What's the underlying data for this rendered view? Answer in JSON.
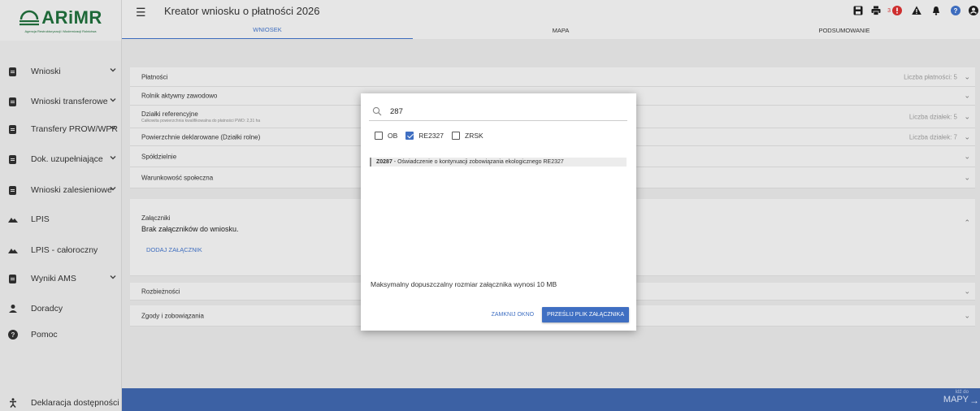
{
  "logo": {
    "name": "ARiMR",
    "subtitle": "Agencja Restrukturyzacji i Modernizacji Rolnictwa"
  },
  "header": {
    "title": "Kreator wniosku o płatności 2026",
    "tabs": [
      {
        "label": "WNIOSEK"
      },
      {
        "label": "MAPA"
      },
      {
        "label": "PODSUMOWANIE"
      }
    ],
    "notification_count": "3"
  },
  "sidebar": {
    "items": [
      {
        "label": "Wnioski"
      },
      {
        "label": "Wnioski transferowe"
      },
      {
        "label": "Transfery PROW/WPR"
      },
      {
        "label": "Dok. uzupełniające"
      },
      {
        "label": "Wnioski zalesieniowe"
      },
      {
        "label": "LPIS"
      },
      {
        "label": "LPIS - całoroczny"
      },
      {
        "label": "Wyniki AMS"
      },
      {
        "label": "Doradcy"
      },
      {
        "label": "Pomoc"
      }
    ],
    "accessibility": "Deklaracja dostępności"
  },
  "sections": {
    "platnosci": {
      "label": "Płatności",
      "right": "Liczba płatności: 5"
    },
    "rolnik": {
      "label": "Rolnik aktywny zawodowo"
    },
    "dzialki": {
      "label": "Działki referencyjne",
      "sub": "Całkowita powierzchnia kwalifikowalna do płatności PWD: 2,31 ha",
      "right": "Liczba działek: 5"
    },
    "powierzchnie": {
      "label": "Powierzchnie deklarowane (Działki rolne)",
      "right": "Liczba działek: 7"
    },
    "spoldzielnie": {
      "label": "Spółdzielnie"
    },
    "warunkowosc": {
      "label": "Warunkowość społeczna"
    },
    "zalaczniki": {
      "label": "Załączniki",
      "empty": "Brak załączników do wniosku.",
      "add": "DODAJ ZAŁĄCZNIK"
    },
    "rozbieznosci": {
      "label": "Rozbieżności"
    },
    "zgody": {
      "label": "Zgody i zobowiązania"
    }
  },
  "footer": {
    "goto_small": "Idź do",
    "goto_big": "MAPY"
  },
  "dialog": {
    "search_value": "287",
    "filters": [
      {
        "label": "OB",
        "checked": false
      },
      {
        "label": "RE2327",
        "checked": true
      },
      {
        "label": "ZRSK",
        "checked": false
      }
    ],
    "result_code": "Z0287",
    "result_text": " - Oświadczenie o kontynuacji zobowiązania ekologicznego RE2327",
    "max_size": "Maksymalny dopuszczalny rozmiar załącznika wynosi 10 MB",
    "close_button": "ZAMKNIJ OKNO",
    "send_button": "PRZEŚLIJ PLIK ZAŁĄCZNIKA"
  },
  "colors": {
    "accent": "#3f6fc2",
    "footer": "#3e63a8",
    "brand_green": "#1f6b3a",
    "alert_red": "#d32f2f"
  }
}
